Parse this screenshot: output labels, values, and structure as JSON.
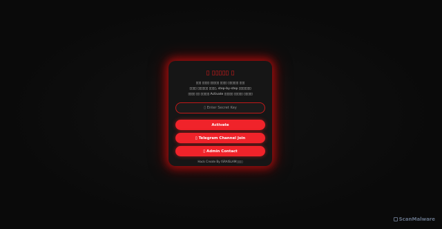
{
  "card": {
    "title": "▯ ▯▯▯▯▯ ▯",
    "description_lines": [
      "▯▯▯ ▯▯▯▯ ▯▯▯▯▯ ▯▯▯▯ ▯▯▯▯▯▯ ▯▯▯",
      "▯▯▯▯ ▯▯▯▯▯▯ ▯▯▯▯, step-by-step ▯▯▯▯▯▯▯",
      "▯▯▯▯ ▯▯ ▯▯▯▯▯ Activate ▯▯▯▯▯ ▯▯▯▯▯ ▯▯▯▯▯"
    ],
    "key_input": {
      "placeholder": "▯ Enter Secret Key",
      "value": ""
    },
    "buttons": {
      "activate": "Activate",
      "telegram": "▯ Telegram Channel Join",
      "admin": "▯ Admin Contact"
    },
    "footer": "Hack Create By ISRAISLAM▯▯▯▯"
  },
  "watermark": {
    "text": "ScanMalware",
    "icon": "scanmalware-logo-icon"
  },
  "colors": {
    "accent": "#f0232a",
    "glow": "#be0f0f",
    "background": "#0b0b0b",
    "card": "#161616"
  }
}
